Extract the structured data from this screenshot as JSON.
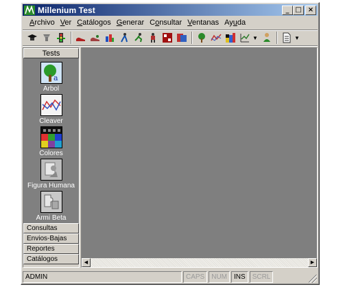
{
  "window": {
    "title": "Millenium Test",
    "controls": [
      "_",
      "□",
      "×"
    ]
  },
  "menu": [
    {
      "label": "Archivo",
      "accel": "A"
    },
    {
      "label": "Ver",
      "accel": "V"
    },
    {
      "label": "Catálogos",
      "accel": "C"
    },
    {
      "label": "Generar",
      "accel": "G"
    },
    {
      "label": "Consultar",
      "accel": "o"
    },
    {
      "label": "Ventanas",
      "accel": "V"
    },
    {
      "label": "Ayuda",
      "accel": "A"
    }
  ],
  "toolbar": {
    "groups": [
      [
        "cap-icon",
        "filter-icon",
        "traffic-light-icon"
      ],
      [
        "shoes-icon",
        "shoes-alt-icon",
        "family-icon",
        "figure-icon",
        "runner-icon",
        "person-icon",
        "board-game-icon",
        "calculator-icon"
      ],
      [
        "tree-icon",
        "graph-icon",
        "color-blocks-icon",
        "chart-icon",
        "human-figure-icon",
        "document-icon"
      ]
    ]
  },
  "sidebar": {
    "active_group": "Tests",
    "launchers": [
      {
        "label": "Arbol",
        "icon": "tree-icon"
      },
      {
        "label": "Cleaver",
        "icon": "line-chart-icon"
      },
      {
        "label": "Colores",
        "icon": "color-grid-icon"
      },
      {
        "label": "Figura Humana",
        "icon": "human-figure-icon"
      },
      {
        "label": "Armi Beta",
        "icon": "puzzle-icon"
      }
    ],
    "groups": [
      "Consultas",
      "Envios-Bajas",
      "Reportes",
      "Catálogos"
    ]
  },
  "statusbar": {
    "user": "ADMIN",
    "caps": "CAPS",
    "num": "NUM",
    "ins": "INS",
    "scrl": "SCRL"
  },
  "colors": {
    "title_start": "#0a246a",
    "title_end": "#a6caf0",
    "workspace": "#7f7f7f",
    "face": "#d4d0c8"
  }
}
